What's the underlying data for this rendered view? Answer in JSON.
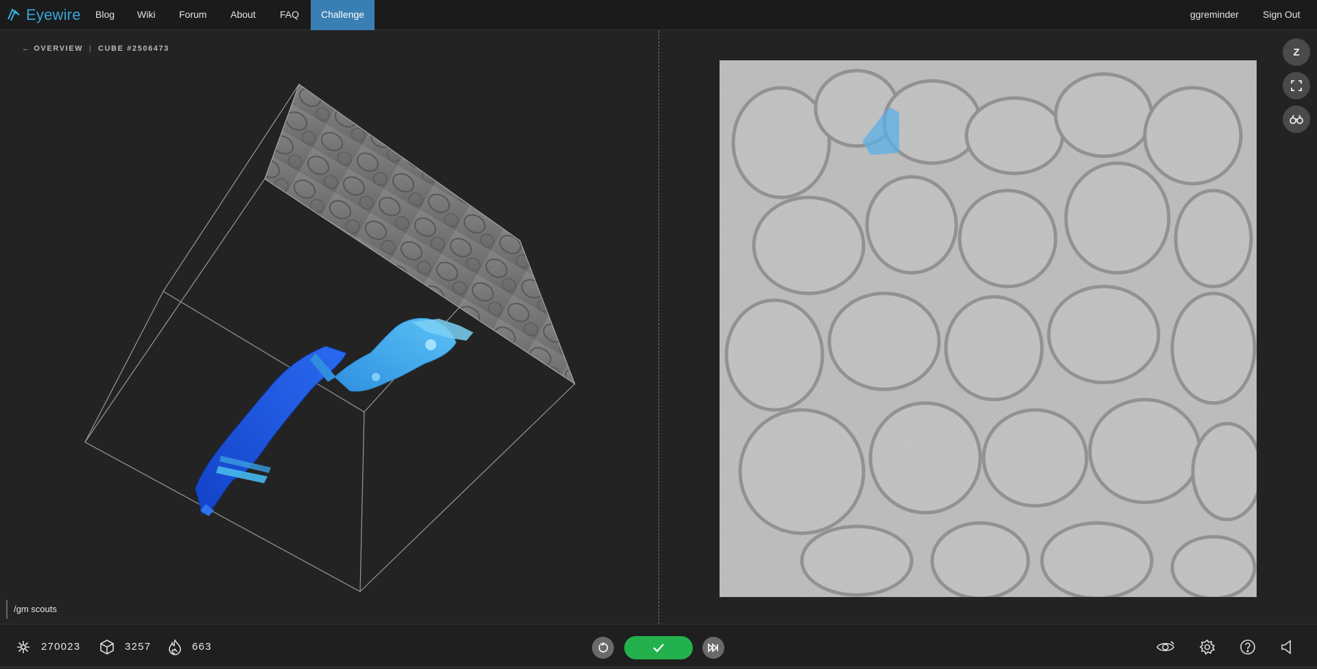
{
  "nav": {
    "logo_text": "Eyewire",
    "links": [
      "Blog",
      "Wiki",
      "Forum",
      "About",
      "FAQ",
      "Challenge"
    ],
    "username": "ggreminder",
    "signout": "Sign Out"
  },
  "breadcrumb": {
    "back_label": "← OVERVIEW",
    "separator": "|",
    "cube_label": "CUBE #2506473"
  },
  "chat": {
    "input_text": "/gm scouts"
  },
  "side_buttons": {
    "z_label": "Z",
    "fullscreen_icon": "fullscreen-icon",
    "binoculars_icon": "binoculars-icon"
  },
  "stats": {
    "points": "270023",
    "cubes": "3257",
    "trailblazes": "663"
  },
  "colors": {
    "accent": "#36a7d8",
    "active_tab": "#3a7fb3",
    "submit": "#22b14c",
    "segment_light": "#3aa6e6",
    "segment_dark": "#1550d8"
  },
  "icons": {
    "points": "sparkle-icon",
    "cubes": "cube-icon",
    "trailblazes": "flame-icon",
    "reset": "reset-icon",
    "submit": "checkmark-icon",
    "skip": "skip-icon",
    "view": "eye-icon",
    "settings": "gear-icon",
    "help": "help-icon",
    "sound": "speaker-icon"
  }
}
